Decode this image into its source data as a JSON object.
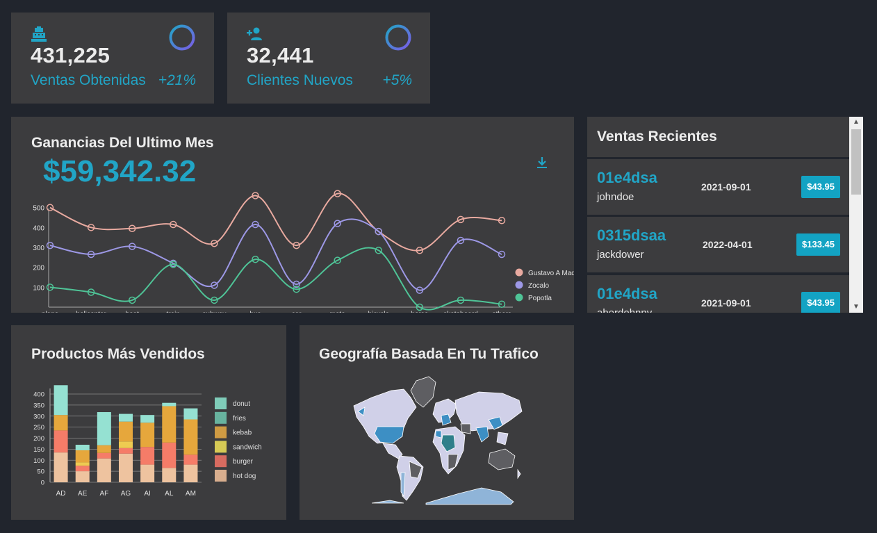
{
  "stats": [
    {
      "value": "431,225",
      "label": "Ventas Obtenidas",
      "change": "+21%",
      "icon": "cash-register-icon"
    },
    {
      "value": "32,441",
      "label": "Clientes Nuevos",
      "change": "+5%",
      "icon": "add-user-icon"
    }
  ],
  "earnings": {
    "title": "Ganancias Del Ultimo Mes",
    "amount": "$59,342.32",
    "download_icon": "download-icon"
  },
  "recent_sales": {
    "title": "Ventas Recientes",
    "rows": [
      {
        "id": "01e4dsa",
        "user": "johndoe",
        "date": "2021-09-01",
        "amount": "$43.95"
      },
      {
        "id": "0315dsaa",
        "user": "jackdower",
        "date": "2022-04-01",
        "amount": "$133.45"
      },
      {
        "id": "01e4dsa",
        "user": "aberdohnny",
        "date": "2021-09-01",
        "amount": "$43.95"
      }
    ]
  },
  "products": {
    "title": "Productos Más Vendidos"
  },
  "geo": {
    "title": "Geografía Basada En Tu Trafico"
  },
  "colors": {
    "accent": "#21a5c6",
    "card": "#3c3c3e",
    "background": "#21252d"
  },
  "chart_data": [
    {
      "type": "line",
      "categories": [
        "plane",
        "helicopter",
        "boat",
        "train",
        "subway",
        "bus",
        "car",
        "moto",
        "bicycle",
        "horse",
        "skateboard",
        "others"
      ],
      "series": [
        {
          "name": "Gustavo A Madero",
          "color": "#e9aaa0",
          "values": [
            500,
            400,
            395,
            415,
            320,
            560,
            310,
            570,
            380,
            285,
            440,
            435
          ]
        },
        {
          "name": "Zocalo",
          "color": "#9d98e6",
          "values": [
            310,
            265,
            305,
            220,
            110,
            415,
            115,
            420,
            380,
            85,
            335,
            265
          ]
        },
        {
          "name": "Popotla",
          "color": "#4fc497",
          "values": [
            100,
            75,
            35,
            215,
            35,
            240,
            90,
            235,
            285,
            0,
            35,
            15
          ]
        }
      ],
      "yticks": [
        100,
        200,
        300,
        400,
        500
      ],
      "ylim": [
        0,
        600
      ],
      "grid": false,
      "legend": "right"
    },
    {
      "type": "bar",
      "stacked": true,
      "categories": [
        "AD",
        "AE",
        "AF",
        "AG",
        "AI",
        "AL",
        "AM"
      ],
      "series": [
        {
          "name": "hot dog",
          "color": "#eec39f",
          "values": [
            135,
            50,
            108,
            130,
            80,
            65,
            80
          ]
        },
        {
          "name": "burger",
          "color": "#f57c68",
          "values": [
            100,
            25,
            25,
            25,
            80,
            115,
            45
          ]
        },
        {
          "name": "sandwich",
          "color": "#eecb51",
          "values": [
            0,
            15,
            0,
            30,
            0,
            0,
            0
          ]
        },
        {
          "name": "kebab",
          "color": "#e6a73c",
          "values": [
            70,
            55,
            35,
            90,
            110,
            165,
            160
          ]
        },
        {
          "name": "fries",
          "color": "#77c3b2",
          "values": [
            0,
            0,
            0,
            0,
            0,
            0,
            0
          ]
        },
        {
          "name": "donut",
          "color": "#95e1d2",
          "values": [
            135,
            25,
            150,
            35,
            35,
            15,
            50
          ]
        }
      ],
      "legend_colors": [
        "#7fccb9",
        "#68b39f",
        "#cf9b43",
        "#d6ca55",
        "#d86b60",
        "#d8ae8e"
      ],
      "yticks": [
        0,
        50,
        100,
        150,
        200,
        250,
        300,
        350,
        400
      ],
      "ylim": [
        0,
        440
      ],
      "grid": true,
      "legend": "right"
    }
  ]
}
